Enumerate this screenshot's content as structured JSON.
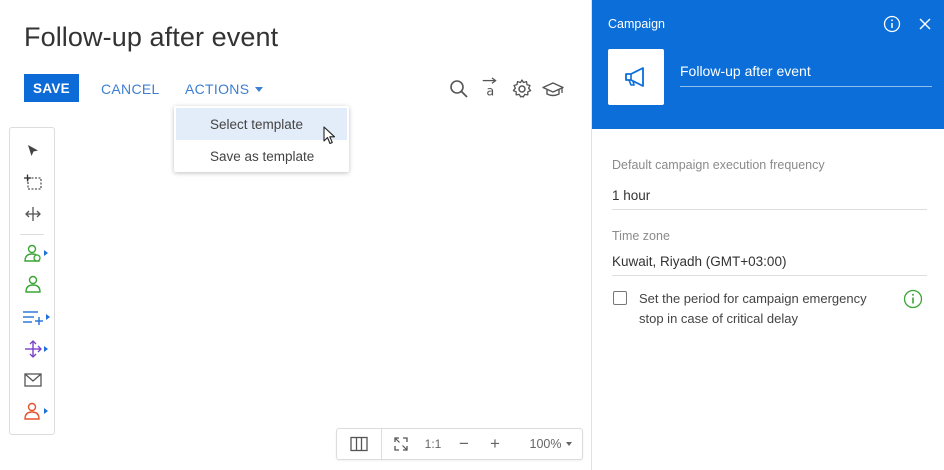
{
  "page": {
    "title": "Follow-up after event"
  },
  "toolbar": {
    "save_label": "SAVE",
    "cancel_label": "CANCEL",
    "actions_label": "ACTIONS",
    "icons": [
      "search-icon",
      "text-format-icon",
      "gear-icon",
      "academy-icon"
    ]
  },
  "actions_menu": {
    "items": [
      {
        "label": "Select template",
        "hovered": true
      },
      {
        "label": "Save as template",
        "hovered": false
      }
    ]
  },
  "toolbox": {
    "tools": [
      "pointer-icon",
      "selection-icon",
      "connector-icon",
      "audience-icon",
      "add-audience-icon",
      "add-to-list-icon",
      "split-icon",
      "email-icon",
      "exit-audience-icon"
    ]
  },
  "zoom": {
    "reset_label": "1:1",
    "minus": "−",
    "plus": "+",
    "level": "100%"
  },
  "panel": {
    "header_title": "Campaign",
    "campaign_name": "Follow-up after event",
    "frequency_label": "Default campaign execution frequency",
    "frequency_value": "1 hour",
    "timezone_label": "Time zone",
    "timezone_value": "Kuwait, Riyadh (GMT+03:00)",
    "emergency_stop_label": "Set the period for campaign emergency stop in case of critical delay",
    "emergency_stop_checked": false
  },
  "colors": {
    "primary": "#0b6ed9",
    "link": "#3d7fd1",
    "green": "#3aa535",
    "purple": "#7a3fc7",
    "orange": "#e5512b"
  }
}
